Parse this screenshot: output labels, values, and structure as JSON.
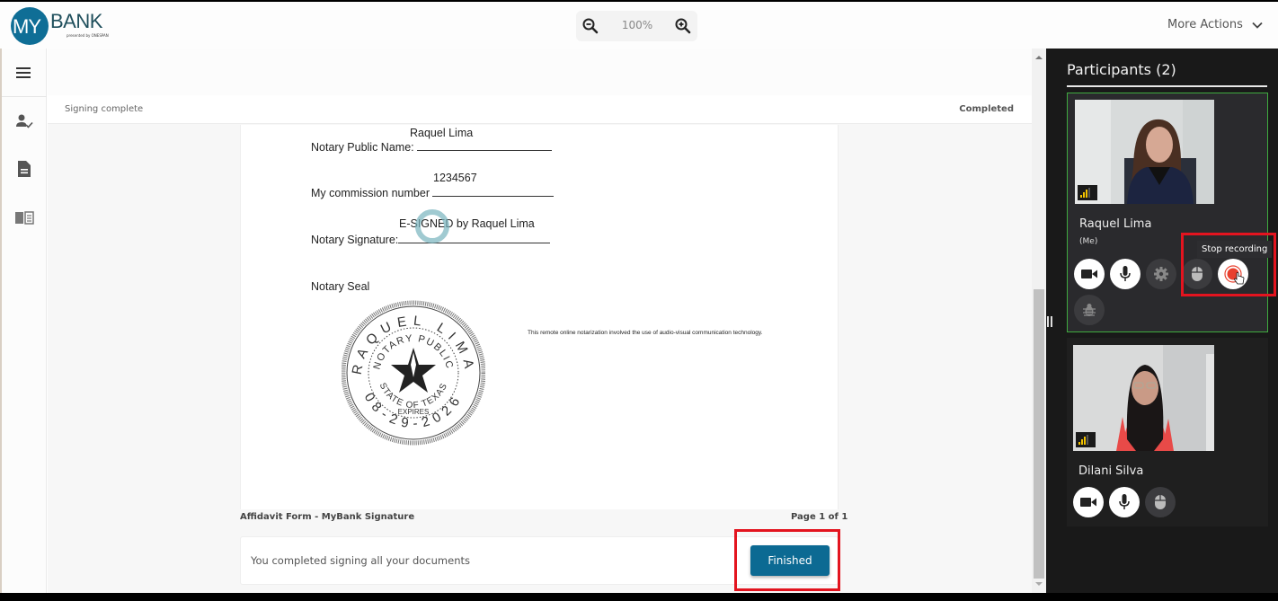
{
  "header": {
    "logo_main": "MY",
    "logo_bank": "BANK",
    "logo_sub": "presented by ONESPAN",
    "zoom_level": "100%",
    "more_actions": "More Actions"
  },
  "nav": {
    "items": [
      {
        "icon": "menu-icon"
      },
      {
        "icon": "signer-check-icon"
      },
      {
        "icon": "document-icon"
      },
      {
        "icon": "book-icon"
      }
    ]
  },
  "status": {
    "left": "Signing complete",
    "right": "Completed"
  },
  "document": {
    "notary_name_value": "Raquel Lima",
    "notary_name_label": "Notary Public Name:",
    "commission_value": "1234567",
    "commission_label": "My commission number",
    "signature_value": "E-SIGNED by Raquel Lima",
    "signature_label": "Notary Signature:",
    "seal_label": "Notary Seal",
    "seal": {
      "name": "RAQUEL LIMA",
      "inner_top": "NOTARY PUBLIC",
      "inner_bottom": "STATE OF TEXAS",
      "expires_label": "EXPIRES",
      "expires_date": "08-29-2026"
    },
    "disclaimer": "This remote online notarization involved the use of audio-visual communication technology.",
    "footer_title": "Affidavit Form - MyBank Signature",
    "footer_page": "Page 1 of 1"
  },
  "completion": {
    "message": "You completed signing all your documents",
    "button": "Finished"
  },
  "participants": {
    "title": "Participants (2)",
    "tooltip": "Stop recording",
    "list": [
      {
        "name": "Raquel Lima",
        "tag": "(Me)",
        "signal_bars": 3,
        "controls": [
          "camera",
          "microphone",
          "settings",
          "mouse",
          "record",
          "bug"
        ]
      },
      {
        "name": "Dilani Silva",
        "tag": "",
        "signal_bars": 3,
        "controls": [
          "camera",
          "microphone",
          "mouse"
        ]
      }
    ]
  },
  "colors": {
    "brand": "#0f6e96",
    "button": "#0c6a93",
    "highlight": "#e3141f",
    "active_border": "#3faa3f",
    "record": "#e8402e"
  }
}
